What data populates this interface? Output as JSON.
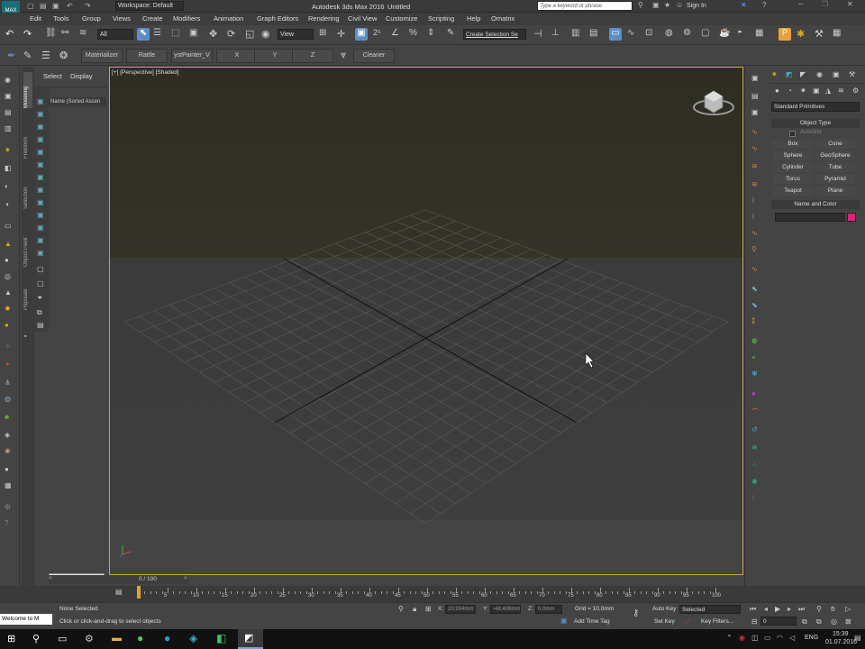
{
  "titlebar": {
    "title": "Autodesk 3ds Max 2016",
    "doc": "Untitled",
    "workspace": "Workspace: Default",
    "search_placeholder": "Type a keyword or phrase",
    "signin": "Sign In"
  },
  "menu": [
    "Edit",
    "Tools",
    "Group",
    "Views",
    "Create",
    "Modifiers",
    "Animation",
    "Graph Editors",
    "Rendering",
    "Civil View",
    "Customize",
    "Scripting",
    "Help",
    "Omatrix"
  ],
  "toolbar1": {
    "filter": "All",
    "refcoord": "View",
    "selection_set": "Create Selection Se"
  },
  "toolbar2": {
    "materializer": "Materializer",
    "rattle": "Rattle",
    "painter": "ystPainter_V",
    "x": "X",
    "y": "Y",
    "z": "Z",
    "cleaner": "Cleaner"
  },
  "scene": {
    "tab_select": "Select",
    "tab_display": "Display",
    "column": "Name (Sorted Ascen"
  },
  "ribbon_tabs": [
    "Modeling",
    "Freeform",
    "Selection",
    "Object Paint",
    "Populate"
  ],
  "viewport": {
    "label": "[+] [Perspective] [Shaded]"
  },
  "cmd": {
    "category": "Standard Primitives",
    "rollout_type": "Object Type",
    "autogrid": "AutoGrid",
    "buttons": [
      "Box",
      "Cone",
      "Sphere",
      "GeoSphere",
      "Cylinder",
      "Tube",
      "Torus",
      "Pyramid",
      "Teapot",
      "Plane"
    ],
    "rollout_name": "Name and Color",
    "color": "#e0207a"
  },
  "timeline": {
    "frame": "0 / 100",
    "ticks": [
      "5",
      "10",
      "15",
      "20",
      "25",
      "30",
      "35",
      "40",
      "45",
      "50",
      "55",
      "60",
      "65",
      "70",
      "75",
      "80",
      "85",
      "90",
      "95",
      "100"
    ]
  },
  "status": {
    "selection": "None Selected",
    "prompt": "Click or click-and-drag to select objects",
    "welcome": "Welcome to M",
    "x": "20,934mm",
    "y": "-48,408mm",
    "z": "0,0mm",
    "grid": "Grid = 10,0mm",
    "autokey": "Auto Key",
    "setkey": "Set Key",
    "selected": "Selected",
    "keyfilters": "Key Filters...",
    "timetag": "Add Time Tag",
    "frame_field": "0"
  },
  "taskbar": {
    "lang": "ENG",
    "time": "15:39",
    "date": "01.07.2016"
  }
}
